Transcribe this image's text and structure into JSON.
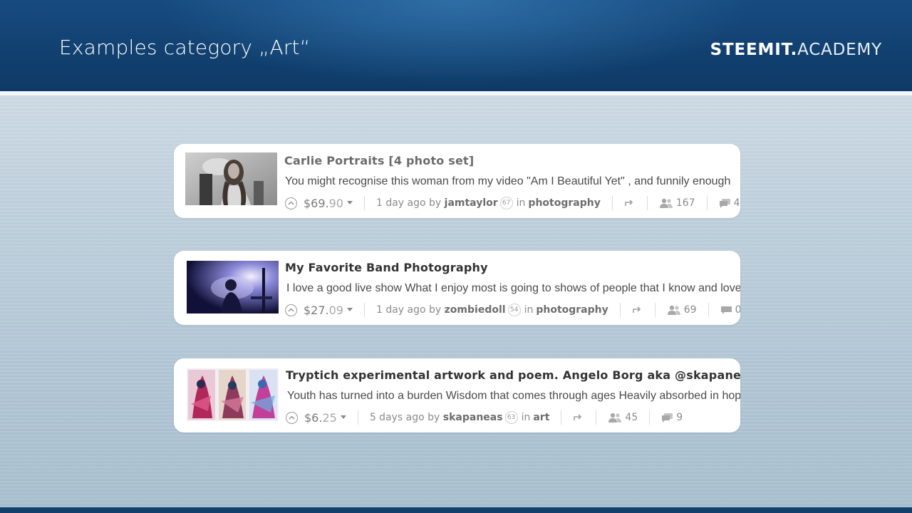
{
  "slide": {
    "title": "Examples category „Art“",
    "brand_strong": "STEEMIT.",
    "brand_light": "ACADEMY"
  },
  "posts": [
    {
      "title": "Carlie Portraits [4 photo set]",
      "summary": "You might recognise this woman from my video \"Am I Beautiful Yet\" , and funnily enough",
      "payout_main": "$69.",
      "payout_cents": "90",
      "time": "1 day ago by",
      "author": "jamtaylor",
      "reputation": "67",
      "in_label": "in",
      "category": "photography",
      "voters": "167",
      "comments": "4"
    },
    {
      "title": "My Favorite Band Photography",
      "summary": "I love a good live show What I enjoy most is going to shows of people that I know and love",
      "payout_main": "$27.",
      "payout_cents": "09",
      "time": "1 day ago by",
      "author": "zombiedoll",
      "reputation": "54",
      "in_label": "in",
      "category": "photography",
      "voters": "69",
      "comments": "0"
    },
    {
      "title": "Tryptich experimental artwork and poem. Angelo Borg aka @skapaneas",
      "summary": "Youth has turned into a burden Wisdom that comes through ages Heavily absorbed in hopes",
      "payout_main": "$6.",
      "payout_cents": "25",
      "time": "5 days ago by",
      "author": "skapaneas",
      "reputation": "63",
      "in_label": "in",
      "category": "art",
      "voters": "45",
      "comments": "9"
    }
  ],
  "icons": {
    "upvote": "upvote-icon",
    "dropdown": "caret-down-icon",
    "reblog": "reblog-icon",
    "voters": "voters-icon",
    "comments": "comments-icon"
  },
  "colors": {
    "header": "#11406f",
    "card": "#ffffff",
    "text": "#333333",
    "muted": "#8a8a8a"
  }
}
